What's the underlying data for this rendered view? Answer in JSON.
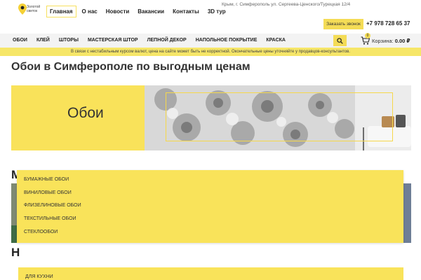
{
  "logo": {
    "line1": "Золотой",
    "line2": "свиток"
  },
  "nav": {
    "items": [
      {
        "label": "Главная",
        "active": true
      },
      {
        "label": "О нас"
      },
      {
        "label": "Новости"
      },
      {
        "label": "Вакансии"
      },
      {
        "label": "Контакты"
      },
      {
        "label": "3D тур"
      }
    ]
  },
  "contacts": {
    "address": "Крым, г. Симферополь ул. Сергеева-Ценского/Турецкая 12/4",
    "callback_label": "Заказать звонок",
    "phone": "+7 978 728 65 37"
  },
  "categories": [
    "ОБОИ",
    "КЛЕЙ",
    "ШТОРЫ",
    "МАСТЕРСКАЯ ШТОР",
    "ЛЕПНОЙ ДЕКОР",
    "НАПОЛЬНОЕ ПОКРЫТИЕ",
    "КРАСКА"
  ],
  "cart": {
    "label": "Корзина:",
    "total": "0.00 ₽",
    "count": "0"
  },
  "notice": "В связи с нестабильным курсом валют, цена на сайте может быть не корректной. Окончательные цены уточняйте у продавцов-консультантов.",
  "page": {
    "title": "Обои в Симферополе по выгодным ценам",
    "banner_title": "Обои",
    "section1_heading": "М",
    "section2_heading": "Н"
  },
  "dropdown_items": [
    "БУМАЖНЫЕ ОБОИ",
    "ВИНИЛОВЫЕ ОБОИ",
    "ФЛИЗЕЛИНОВЫЕ ОБОИ",
    "ТЕКСТИЛЬНЫЕ ОБОИ",
    "СТЕКЛООБОИ"
  ],
  "dropdown2_items": [
    "ДЛЯ КУХНИ"
  ],
  "colors": {
    "accent": "#f4dc56",
    "notice_bg": "#f6e668",
    "catbar_bg": "#f3f3f3"
  },
  "icons": {
    "search": "search-icon",
    "cart": "cart-icon",
    "logo": "location-pin-icon"
  }
}
